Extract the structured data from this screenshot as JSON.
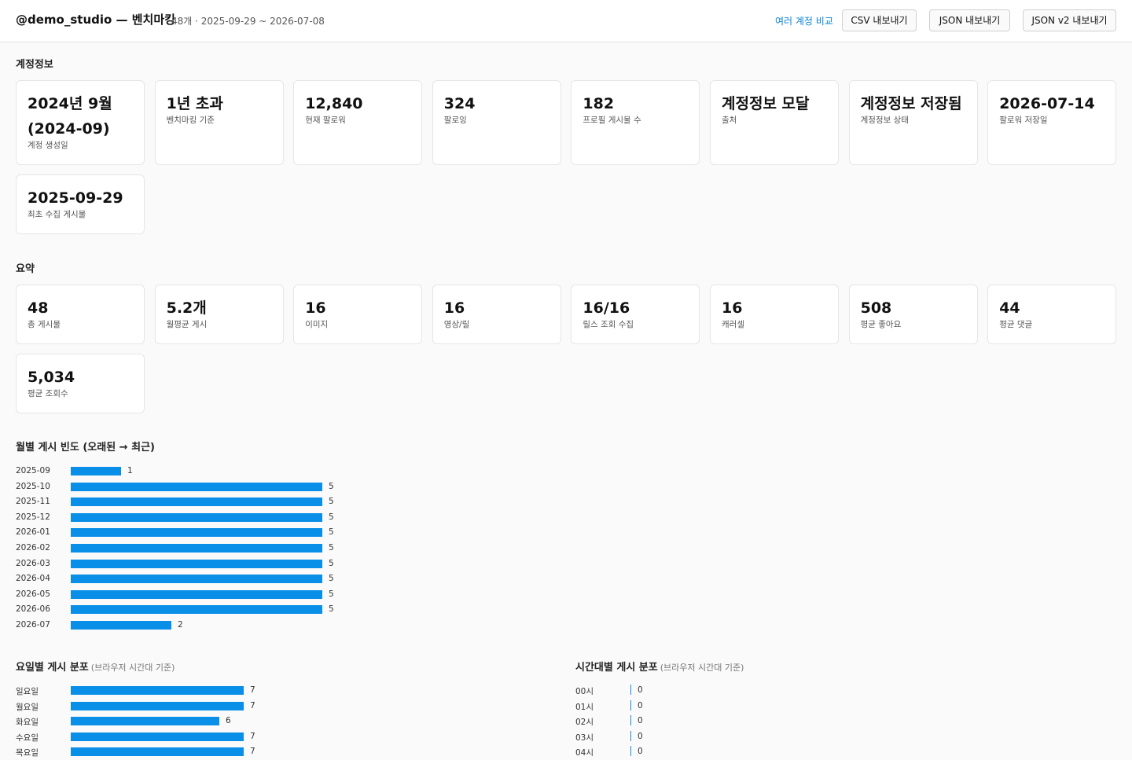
{
  "header": {
    "title": "@demo_studio — 벤치마킹",
    "meta": "48개 · 2025-09-29 ~ 2026-07-08",
    "compare_link": "여러 계정 비교",
    "buttons": [
      "CSV 내보내기",
      "JSON 내보내기",
      "JSON v2 내보내기"
    ]
  },
  "account": {
    "title": "계정정보",
    "cards": [
      {
        "value": "2024년 9월 (2024-09)",
        "label": "계정 생성일"
      },
      {
        "value": "1년 초과",
        "label": "벤치마킹 기준"
      },
      {
        "value": "12,840",
        "label": "현재 팔로워"
      },
      {
        "value": "324",
        "label": "팔로잉"
      },
      {
        "value": "182",
        "label": "프로필 게시물 수"
      },
      {
        "value": "계정정보 모달",
        "label": "출처"
      },
      {
        "value": "계정정보 저장됨",
        "label": "계정정보 상태"
      },
      {
        "value": "2026-07-14",
        "label": "팔로워 저장일"
      },
      {
        "value": "2025-09-29",
        "label": "최초 수집 게시물"
      }
    ]
  },
  "summary": {
    "title": "요약",
    "cards": [
      {
        "value": "48",
        "label": "총 게시물"
      },
      {
        "value": "5.2개",
        "label": "월평균 게시"
      },
      {
        "value": "16",
        "label": "이미지"
      },
      {
        "value": "16",
        "label": "영상/릴"
      },
      {
        "value": "16/16",
        "label": "릴스 조회 수집"
      },
      {
        "value": "16",
        "label": "캐러셀"
      },
      {
        "value": "508",
        "label": "평균 좋아요"
      },
      {
        "value": "44",
        "label": "평균 댓글"
      },
      {
        "value": "5,034",
        "label": "평균 조회수"
      }
    ]
  },
  "monthly": {
    "title": "월별 게시 빈도 (오래된 → 최근)",
    "max": 5,
    "rows": [
      {
        "label": "2025-09",
        "value": 1
      },
      {
        "label": "2025-10",
        "value": 5
      },
      {
        "label": "2025-11",
        "value": 5
      },
      {
        "label": "2025-12",
        "value": 5
      },
      {
        "label": "2026-01",
        "value": 5
      },
      {
        "label": "2026-02",
        "value": 5
      },
      {
        "label": "2026-03",
        "value": 5
      },
      {
        "label": "2026-04",
        "value": 5
      },
      {
        "label": "2026-05",
        "value": 5
      },
      {
        "label": "2026-06",
        "value": 5
      },
      {
        "label": "2026-07",
        "value": 2
      }
    ]
  },
  "weekday": {
    "title": "요일별 게시 분포",
    "note": "(브라우저 시간대 기준)",
    "max": 7,
    "rows": [
      {
        "label": "일요일",
        "value": 7
      },
      {
        "label": "월요일",
        "value": 7
      },
      {
        "label": "화요일",
        "value": 6
      },
      {
        "label": "수요일",
        "value": 7
      },
      {
        "label": "목요일",
        "value": 7
      }
    ]
  },
  "hourly": {
    "title": "시간대별 게시 분포",
    "note": "(브라우저 시간대 기준)",
    "rows": [
      {
        "label": "00시",
        "value": 0
      },
      {
        "label": "01시",
        "value": 0
      },
      {
        "label": "02시",
        "value": 0
      },
      {
        "label": "03시",
        "value": 0
      },
      {
        "label": "04시",
        "value": 0
      }
    ]
  },
  "colors": {
    "accent": "#0a8fe8",
    "link": "#0a84d6"
  }
}
